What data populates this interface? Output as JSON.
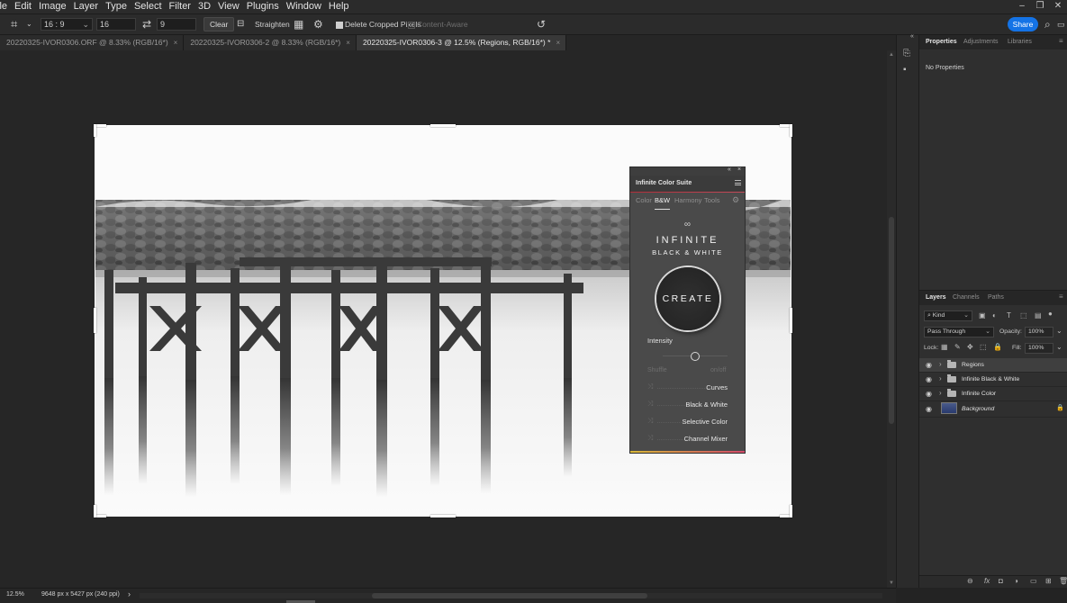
{
  "menu": [
    "ile",
    "Edit",
    "Image",
    "Layer",
    "Type",
    "Select",
    "Filter",
    "3D",
    "View",
    "Plugins",
    "Window",
    "Help"
  ],
  "window_controls": [
    "–",
    "❐",
    "✕"
  ],
  "options_bar": {
    "ratio_preset": "16 : 9",
    "width_value": "16",
    "height_value": "9",
    "swap_icon": "⇄",
    "clear_label": "Clear",
    "straighten_label": "Straighten",
    "delete_cropped_label": "Delete Cropped Pixels",
    "delete_cropped_checked": true,
    "content_aware_label": "Content-Aware",
    "content_aware_checked": false,
    "share_label": "Share"
  },
  "tabs": [
    {
      "label": "20220325-IVOR0306.ORF @ 8.33% (RGB/16*)",
      "close": "×"
    },
    {
      "label": "20220325-IVOR0306-2 @ 8.33% (RGB/16*)",
      "close": "×"
    },
    {
      "label": "20220325-IVOR0306-3 @ 12.5% (Regions, RGB/16*) *",
      "close": "×"
    }
  ],
  "ics_panel": {
    "title": "Infinite Color Suite",
    "close": "×",
    "collapse": "«",
    "tabs": [
      "Color",
      "B&W",
      "Harmony",
      "Tools"
    ],
    "active_tab": "B&W",
    "logo_line1": "INFINITE",
    "logo_line2": "BLACK & WHITE",
    "create_label": "CREATE",
    "intensity_label": "Intensity",
    "intensity_level": 0.5,
    "shuffle_label": "Shuffle",
    "onoff_label": "on/off",
    "adjustments": [
      "Curves",
      "Black & White",
      "Selective Color",
      "Channel Mixer"
    ],
    "accent_color": "#b22e3a"
  },
  "right_panels": {
    "top_tabs": [
      "Properties",
      "Adjustments",
      "Libraries"
    ],
    "no_properties": "No Properties",
    "layer_tabs": [
      "Layers",
      "Channels",
      "Paths"
    ],
    "kind_filter": "Kind",
    "blend_mode": "Pass Through",
    "opacity_label": "Opacity:",
    "opacity_value": "100%",
    "lock_label": "Lock:",
    "fill_label": "Fill:",
    "fill_value": "100%",
    "layers": [
      {
        "name": "Regions",
        "type": "group",
        "active": true
      },
      {
        "name": "Infinite Black & White",
        "type": "group",
        "active": false
      },
      {
        "name": "Infinite Color",
        "type": "group",
        "active": false
      },
      {
        "name": "Background",
        "type": "image",
        "active": false,
        "locked": true
      }
    ]
  },
  "status_bar": {
    "zoom": "12.5%",
    "doc_info": "9648 px x 5427 px (240 ppi)",
    "arrow": "›"
  }
}
